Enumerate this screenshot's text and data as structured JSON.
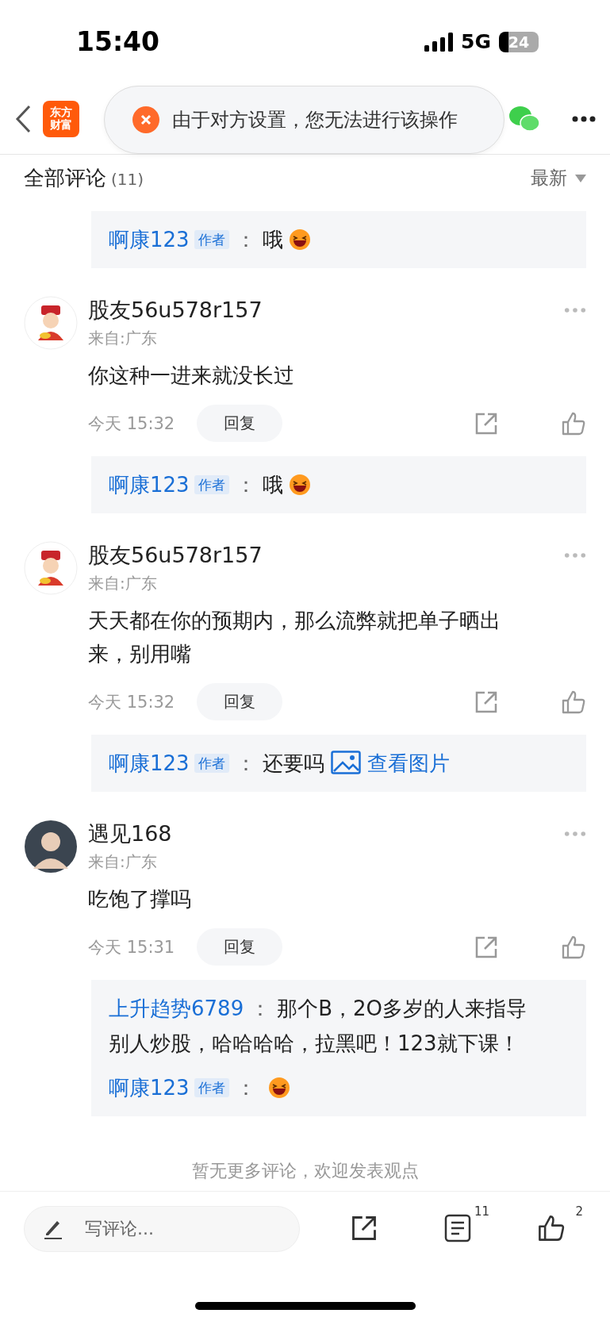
{
  "status_bar": {
    "time": "15:40",
    "network": "5G",
    "battery": "24"
  },
  "nav": {
    "logo": [
      "东方",
      "财富"
    ]
  },
  "toast": {
    "message": "由于对方设置，您无法进行该操作"
  },
  "header": {
    "title": "全部评论",
    "count": "(11)",
    "sort": "最新"
  },
  "top_replies": [
    {
      "author": "啊康123",
      "badge": "作者",
      "sep": "：",
      "content": [
        {
          "kind": "text",
          "text": "哦"
        },
        {
          "kind": "emoji"
        }
      ]
    }
  ],
  "comments": [
    {
      "avatar": {
        "kind": "figure"
      },
      "name": "股友56u578r157",
      "location": "来自:广东",
      "text": "你这种一进来就没长过",
      "time": "今天 15:32",
      "reply_button": "回复",
      "replies": [
        {
          "author": "啊康123",
          "badge": "作者",
          "sep": "：",
          "content": [
            {
              "kind": "text",
              "text": "哦"
            },
            {
              "kind": "emoji"
            }
          ]
        }
      ]
    },
    {
      "avatar": {
        "kind": "figure"
      },
      "name": "股友56u578r157",
      "location": "来自:广东",
      "text": "天天都在你的预期内，那么流弊就把单子晒出来，别用嘴",
      "time": "今天 15:32",
      "reply_button": "回复",
      "replies": [
        {
          "author": "啊康123",
          "badge": "作者",
          "sep": "：",
          "content": [
            {
              "kind": "text",
              "text": "还要吗"
            },
            {
              "kind": "image_link",
              "text": "查看图片"
            }
          ]
        }
      ]
    },
    {
      "avatar": {
        "kind": "silhouette"
      },
      "name": "遇见168",
      "location": "来自:广东",
      "text": "吃饱了撑吗",
      "time": "今天 15:31",
      "reply_button": "回复",
      "replies": [
        {
          "author": "上升趋势6789",
          "sep": "：",
          "content": [
            {
              "kind": "text",
              "text": "那个B，2O多岁的人来指导别人炒股，哈哈哈哈，拉黑吧！123就下课！"
            }
          ]
        },
        {
          "author": "啊康123",
          "badge": "作者",
          "sep": "：",
          "content": [
            {
              "kind": "emoji"
            }
          ]
        }
      ]
    }
  ],
  "footer_note": "暂无更多评论，欢迎发表观点",
  "bottom_bar": {
    "placeholder": "写评论...",
    "comment_count": "11",
    "like_count": "2"
  }
}
